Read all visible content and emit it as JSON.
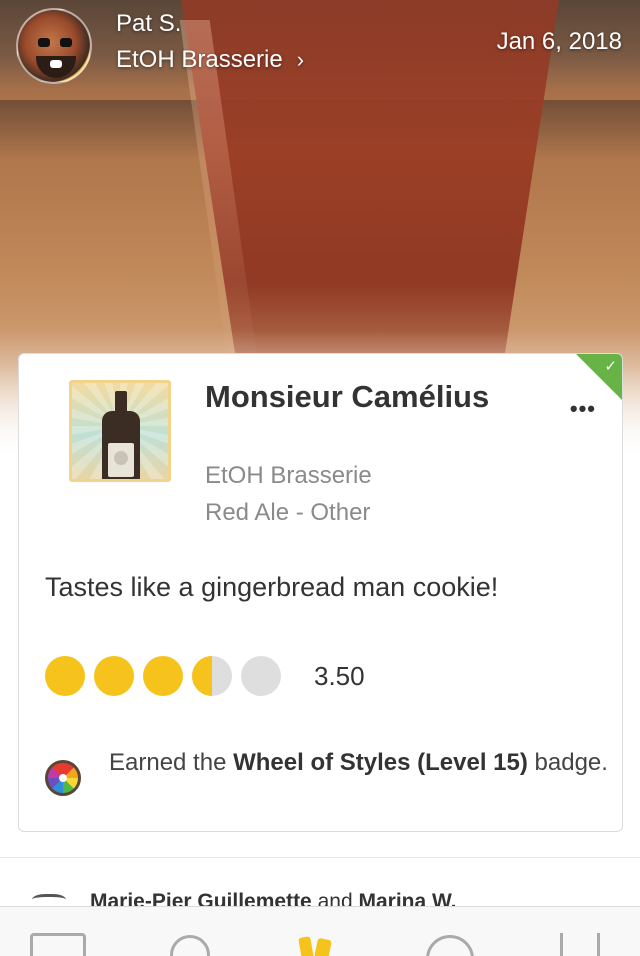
{
  "header": {
    "user_name": "Pat S.",
    "venue": "EtOH Brasserie",
    "venue_chevron": "›",
    "date": "Jan 6, 2018"
  },
  "checkin": {
    "beer_name": "Monsieur Camélius",
    "brewery": "EtOH Brasserie",
    "style": "Red Ale - Other",
    "comment": "Tastes like a gingerbread man cookie!",
    "rating": {
      "value": 3.5,
      "max": 5,
      "label": "3.50"
    },
    "more_menu": "•••",
    "verified_glyph": "✓",
    "badge": {
      "prefix": "Earned the",
      "name": "Wheel of Styles (Level 15)",
      "suffix": "badge."
    }
  },
  "toasts": {
    "name_1": "Marie-Pier Guillemette",
    "conjunction": "and",
    "name_2": "Marina W."
  },
  "tab_bar": {
    "tabs": [
      "feed",
      "search",
      "checkin",
      "nearby",
      "profile"
    ],
    "active": "checkin"
  },
  "colors": {
    "accent": "#f6c21c",
    "verified": "#67b346"
  }
}
